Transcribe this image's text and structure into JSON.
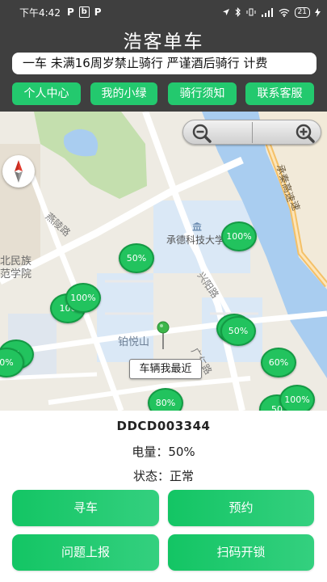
{
  "status_bar": {
    "time": "下午4:42",
    "app_icons": [
      "P",
      "b",
      "P"
    ],
    "battery": "21"
  },
  "header": {
    "title": "浩客单车",
    "notice": "一车 未满16周岁禁止骑行 严谨酒后骑行 计费"
  },
  "nav": [
    {
      "label": "个人中心"
    },
    {
      "label": "我的小绿"
    },
    {
      "label": "骑行须知"
    },
    {
      "label": "联系客服"
    }
  ],
  "map": {
    "labels": {
      "university": "承德科技大学",
      "poi": "铂悦山",
      "school_line1": "北民族",
      "school_line2": "范学院",
      "road_yanshan": "燕陵路",
      "road_xinyang": "兴阳路",
      "road_guangren": "广仁路",
      "highway_line1": "承秦高速",
      "highway_line2": "速"
    },
    "markers": [
      "100%",
      "50%",
      "100%",
      "100",
      "50%",
      "%",
      "0%",
      "60%",
      "80%",
      "100%",
      "50"
    ],
    "tooltip": "车辆我最近"
  },
  "info": {
    "bike_id": "DDCD003344",
    "battery_label": "电量：",
    "battery_value": "50%",
    "status_label": "状态：",
    "status_value": "正常"
  },
  "actions": {
    "find": "寻车",
    "reserve": "预约",
    "report": "问题上报",
    "scan": "扫码开锁"
  },
  "colors": {
    "header_bg": "#3f3f3f",
    "accent_green": "#23c96e",
    "water": "#a9cdf0"
  }
}
